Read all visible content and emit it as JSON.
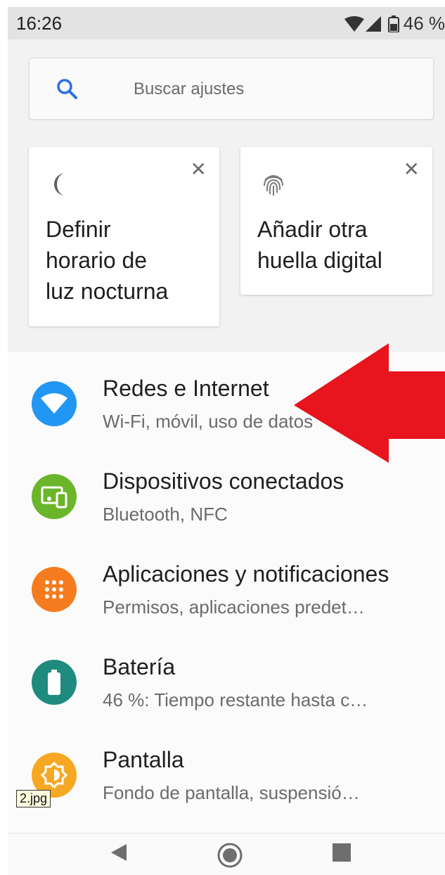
{
  "status_bar": {
    "time": "16:26",
    "battery_text": "46 %"
  },
  "search": {
    "placeholder": "Buscar ajustes",
    "icon": "search-icon"
  },
  "suggestions": [
    {
      "icon": "moon-icon",
      "text": "Definir horario de luz nocturna",
      "lines": [
        "Definir",
        "horario de",
        "luz nocturna"
      ]
    },
    {
      "icon": "fingerprint-icon",
      "text": "Añadir otra huella digital",
      "lines": [
        "Añadir otra",
        "huella digital"
      ]
    }
  ],
  "settings": [
    {
      "title": "Redes e Internet",
      "subtitle": "Wi-Fi, móvil, uso de datos",
      "icon": "wifi-icon",
      "color": "#2196F3"
    },
    {
      "title": "Dispositivos conectados",
      "subtitle": "Bluetooth, NFC",
      "icon": "devices-icon",
      "color": "#6BB52A"
    },
    {
      "title": "Aplicaciones y notificaciones",
      "subtitle": "Permisos, aplicaciones predet…",
      "icon": "apps-icon",
      "color": "#F57C1E"
    },
    {
      "title": "Batería",
      "subtitle": "46 %: Tiempo restante hasta c…",
      "icon": "battery-icon",
      "color": "#1E8B7E"
    },
    {
      "title": "Pantalla",
      "subtitle": "Fondo de pantalla, suspensió…",
      "icon": "display-icon",
      "color": "#F7A823"
    }
  ],
  "overlay": {
    "file_tag": "2.jpg",
    "arrow_color": "#E8141E"
  },
  "nav": {
    "back": "back-icon",
    "home": "home-icon",
    "recents": "recents-icon"
  }
}
